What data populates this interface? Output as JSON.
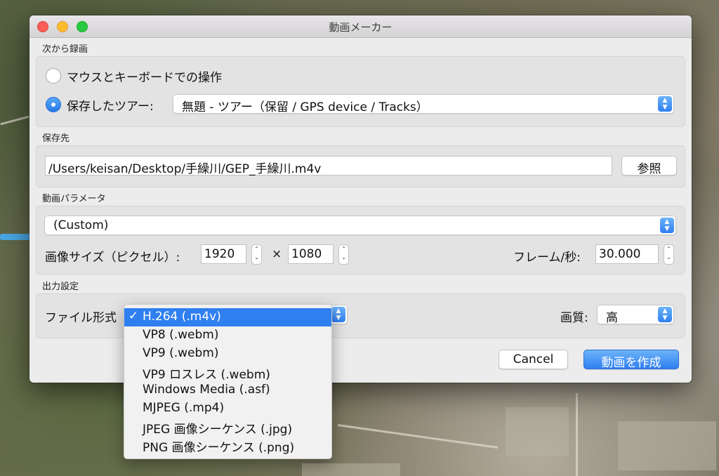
{
  "window": {
    "title": "動画メーカー"
  },
  "record_from": {
    "section": "次から録画",
    "option_mouse": "マウスとキーボードでの操作",
    "option_tour": "保存したツアー:",
    "tour_value": "無題 - ツアー（保留 / GPS device / Tracks）"
  },
  "save_to": {
    "section": "保存先",
    "path": "/Users/keisan/Desktop/手繰川/GEP_手繰川.m4v",
    "browse_label": "参照"
  },
  "video_params": {
    "section": "動画パラメータ",
    "preset": "(Custom)",
    "size_label": "画像サイズ（ピクセル）:",
    "width": "1920",
    "times": "×",
    "height": "1080",
    "fps_label": "フレーム/秒:",
    "fps": "30.000"
  },
  "output": {
    "section": "出力設定",
    "format_label": "ファイル形式",
    "quality_label": "画質:",
    "quality_value": "高",
    "format_options": [
      "H.264 (.m4v)",
      "VP8 (.webm)",
      "VP9 (.webm)",
      "VP9 ロスレス (.webm)",
      "Windows Media (.asf)",
      "MJPEG (.mp4)",
      "JPEG 画像シーケンス (.jpg)",
      "PNG 画像シーケンス (.png)"
    ],
    "selected_index": 0
  },
  "buttons": {
    "cancel": "Cancel",
    "create": "動画を作成"
  },
  "colors": {
    "accent": "#2f7ff0",
    "close": "#fc5f57",
    "minimize": "#fdbc2e",
    "maximize": "#28c840"
  }
}
